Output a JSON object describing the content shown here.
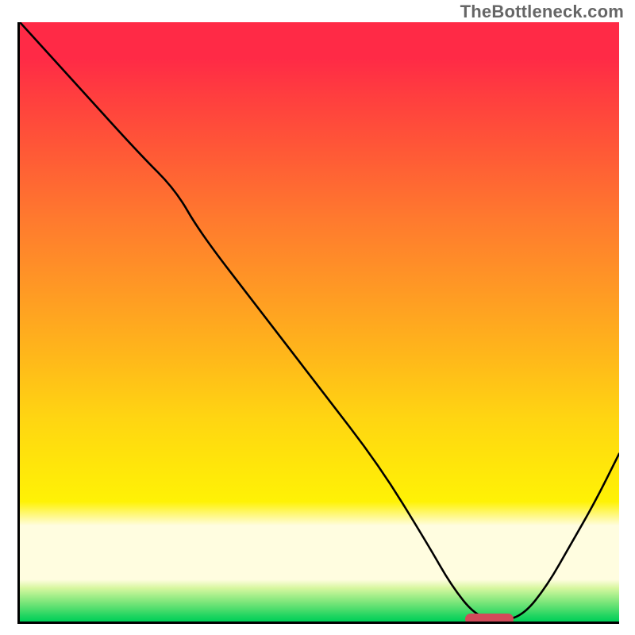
{
  "watermark": "TheBottleneck.com",
  "colors": {
    "axis": "#000000",
    "curve": "#000000",
    "marker": "#d24a5a",
    "gradient_top": "#ff2a46",
    "gradient_mid": "#ffd512",
    "gradient_pale": "#fffde0",
    "gradient_bottom": "#00cf58"
  },
  "chart_data": {
    "type": "line",
    "title": "",
    "xlabel": "",
    "ylabel": "",
    "xlim": [
      0,
      100
    ],
    "ylim": [
      0,
      100
    ],
    "grid": false,
    "legend": false,
    "annotations": [
      {
        "text": "TheBottleneck.com",
        "position": "top-right"
      }
    ],
    "series": [
      {
        "name": "bottleneck-curve",
        "x": [
          0,
          10,
          20,
          26,
          30,
          40,
          50,
          60,
          68,
          72,
          76,
          80,
          84,
          88,
          92,
          96,
          100
        ],
        "y": [
          100,
          89,
          78,
          72,
          65,
          52,
          39,
          26,
          13,
          6,
          1,
          0,
          1,
          6,
          13,
          20,
          28
        ]
      }
    ],
    "marker": {
      "x_start": 74,
      "x_end": 82,
      "y": 0.8,
      "note": "optimal range indicator (pill on x-axis)"
    },
    "gradient_bands_pct_from_top": {
      "red": [
        0,
        22
      ],
      "orange": [
        22,
        56
      ],
      "yellow": [
        56,
        80
      ],
      "pale_yellow": [
        80,
        93
      ],
      "green": [
        93,
        100
      ]
    }
  }
}
